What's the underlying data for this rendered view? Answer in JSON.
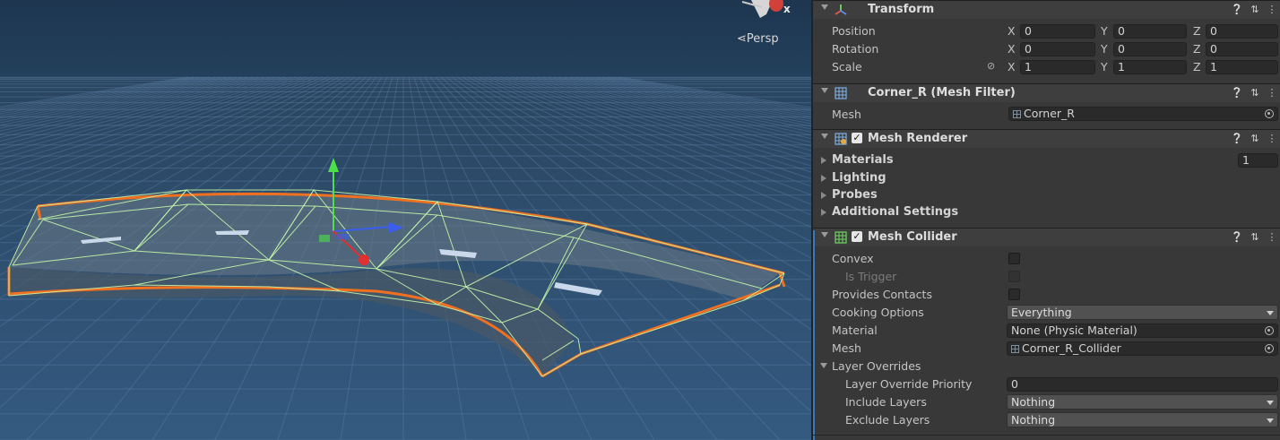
{
  "scene": {
    "view_label": "Persp",
    "gizmo_axis": "x"
  },
  "transform": {
    "title": "Transform",
    "position": {
      "label": "Position",
      "x": "0",
      "y": "0",
      "z": "0"
    },
    "rotation": {
      "label": "Rotation",
      "x": "0",
      "y": "0",
      "z": "0"
    },
    "scale": {
      "label": "Scale",
      "x": "1",
      "y": "1",
      "z": "1"
    },
    "axes": {
      "x": "X",
      "y": "Y",
      "z": "Z"
    }
  },
  "mesh_filter": {
    "title": "Corner_R (Mesh Filter)",
    "mesh_label": "Mesh",
    "mesh_value": "Corner_R"
  },
  "mesh_renderer": {
    "title": "Mesh Renderer",
    "enabled": true,
    "materials_label": "Materials",
    "materials_count": "1",
    "lighting_label": "Lighting",
    "probes_label": "Probes",
    "additional_label": "Additional Settings"
  },
  "mesh_collider": {
    "title": "Mesh Collider",
    "enabled": true,
    "convex_label": "Convex",
    "is_trigger_label": "Is Trigger",
    "provides_contacts_label": "Provides Contacts",
    "cooking_label": "Cooking Options",
    "cooking_value": "Everything",
    "material_label": "Material",
    "material_value": "None (Physic Material)",
    "mesh_label": "Mesh",
    "mesh_value": "Corner_R_Collider",
    "layer_overrides_label": "Layer Overrides",
    "priority_label": "Layer Override Priority",
    "priority_value": "0",
    "include_label": "Include Layers",
    "include_value": "Nothing",
    "exclude_label": "Exclude Layers",
    "exclude_value": "Nothing"
  },
  "header_icons": [
    "help-icon",
    "presets-icon",
    "more-icon"
  ],
  "colors": {
    "sky": "#1f3a55",
    "ground": "#2d4a66",
    "selection_outline": "#f07020",
    "collider_wire": "#b8f0a0",
    "accent_blue": "#3a79bb"
  }
}
